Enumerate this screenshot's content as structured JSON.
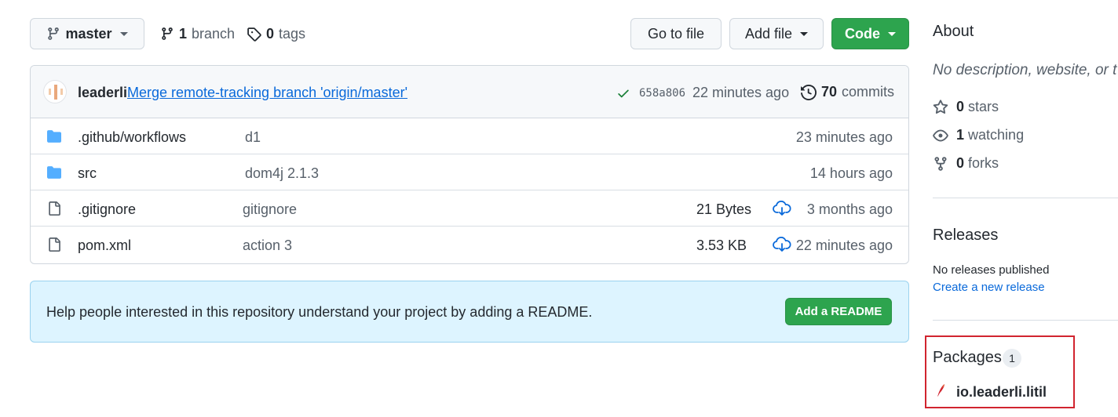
{
  "toolbar": {
    "branch_select": "master",
    "branch_count": "1",
    "branch_label": "branch",
    "tag_count": "0",
    "tag_label": "tags",
    "go_to_file": "Go to file",
    "add_file": "Add file",
    "code": "Code"
  },
  "commit": {
    "author": "leaderli",
    "message": "Merge remote-tracking branch 'origin/master'",
    "sha": "658a806",
    "time": "22 minutes ago",
    "commit_count": "70",
    "commit_label": "commits"
  },
  "files": [
    {
      "type": "folder",
      "name": ".github/workflows",
      "message": "d1",
      "size": "",
      "age": "23 minutes ago"
    },
    {
      "type": "folder",
      "name": "src",
      "message": "dom4j 2.1.3",
      "size": "",
      "age": "14 hours ago"
    },
    {
      "type": "file",
      "name": ".gitignore",
      "message": "gitignore",
      "size": "21 Bytes",
      "age": "3 months ago"
    },
    {
      "type": "file",
      "name": "pom.xml",
      "message": "action 3",
      "size": "3.53 KB",
      "age": "22 minutes ago"
    }
  ],
  "readme": {
    "text": "Help people interested in this repository understand your project by adding a README.",
    "button": "Add a README"
  },
  "sidebar": {
    "about_title": "About",
    "about_desc": "No description, website, or t",
    "stars_count": "0",
    "stars_label": "stars",
    "watching_count": "1",
    "watching_label": "watching",
    "forks_count": "0",
    "forks_label": "forks",
    "releases_title": "Releases",
    "releases_none": "No releases published",
    "releases_link": "Create a new release",
    "packages_title": "Packages",
    "packages_count": "1",
    "package_name": "io.leaderli.litil"
  },
  "colors": {
    "accent_green": "#2da44e",
    "link_blue": "#0969da",
    "folder_blue": "#54aeff",
    "highlight_red": "#d1242f"
  }
}
